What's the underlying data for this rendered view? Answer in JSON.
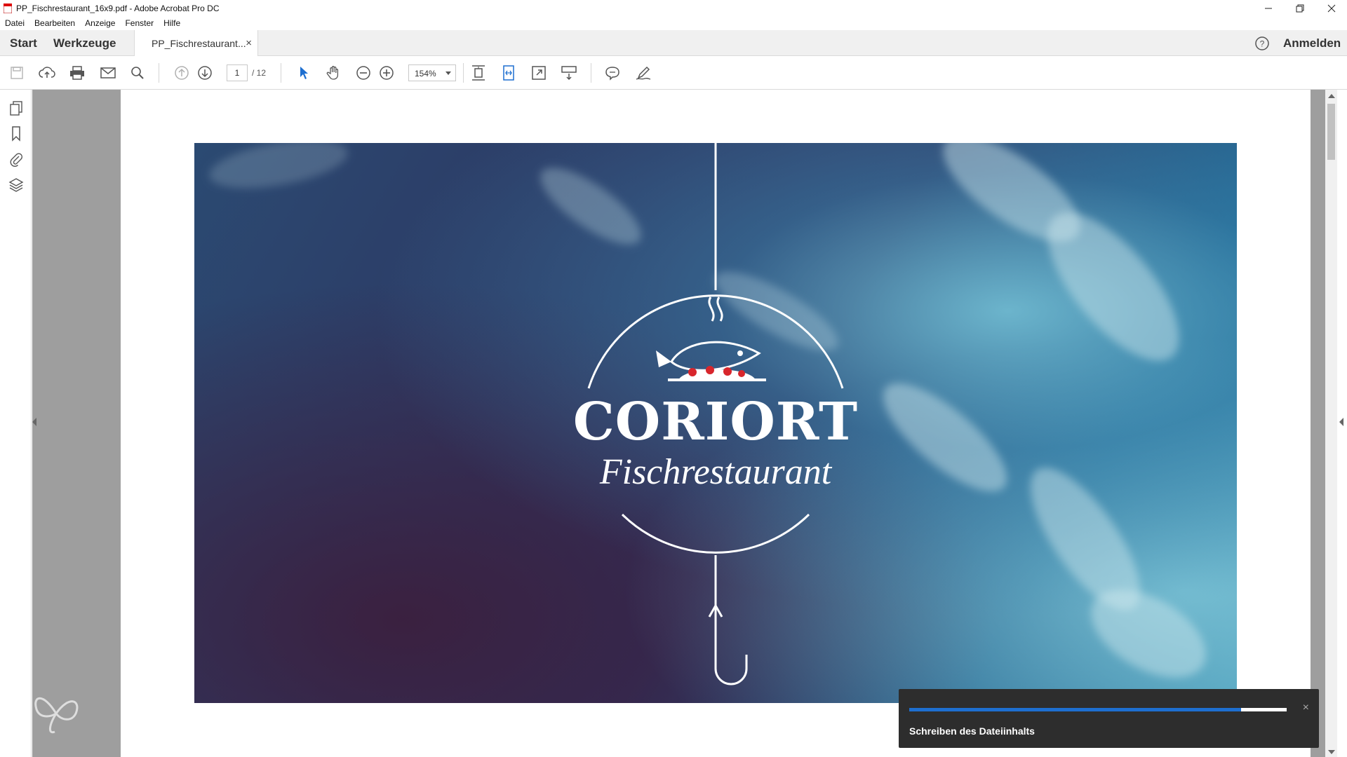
{
  "window": {
    "title": "PP_Fischrestaurant_16x9.pdf - Adobe Acrobat Pro DC"
  },
  "menu": {
    "items": [
      "Datei",
      "Bearbeiten",
      "Anzeige",
      "Fenster",
      "Hilfe"
    ]
  },
  "tabs": {
    "home": "Start",
    "tools": "Werkzeuge",
    "document": "PP_Fischrestaurant...",
    "close_symbol": "×",
    "sign_in": "Anmelden"
  },
  "toolbar": {
    "page_current": "1",
    "page_total": "/ 12",
    "zoom": "154%"
  },
  "slide": {
    "brand_name": "CORIORT",
    "brand_subtitle": "Fischrestaurant",
    "colors": {
      "deep": "#2f305c",
      "water": "#3a8fb0",
      "accent_red": "#d8262c"
    }
  },
  "toast": {
    "message": "Schreiben des Dateiinhalts",
    "progress_fraction": 0.88,
    "close_symbol": "×",
    "accent": "#1e6fd0"
  }
}
